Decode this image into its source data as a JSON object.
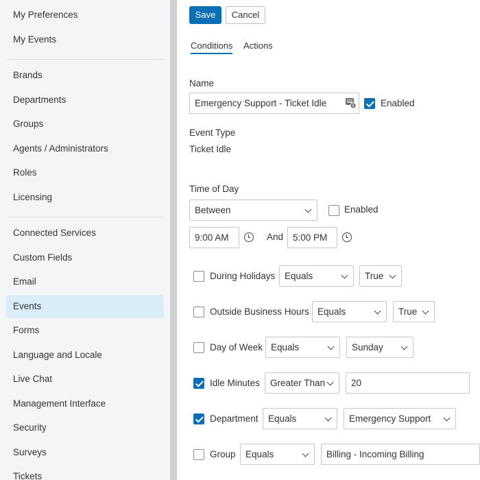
{
  "sidebar": {
    "group1": [
      "My Preferences",
      "My Events"
    ],
    "group2": [
      "Brands",
      "Departments",
      "Groups",
      "Agents / Administrators",
      "Roles",
      "Licensing"
    ],
    "group3": [
      "Connected Services",
      "Custom Fields",
      "Email",
      "Events",
      "Forms",
      "Language and Locale",
      "Live Chat",
      "Management Interface",
      "Security",
      "Surveys",
      "Tickets"
    ],
    "active": "Events"
  },
  "toolbar": {
    "save_label": "Save",
    "cancel_label": "Cancel"
  },
  "tabs": [
    {
      "label": "Conditions",
      "active": true
    },
    {
      "label": "Actions",
      "active": false
    }
  ],
  "form": {
    "name_label": "Name",
    "name_value": "Emergency Support - Ticket Idle",
    "enabled_label": "Enabled",
    "enabled_checked": true,
    "event_type_label": "Event Type",
    "event_type_value": "Ticket Idle",
    "time_of_day_label": "Time of Day",
    "time_of_day_mode": "Between",
    "time_enabled_label": "Enabled",
    "time_enabled_checked": false,
    "start_time": "9:00 AM",
    "and_label": "And",
    "end_time": "5:00 PM"
  },
  "conditions": [
    {
      "label": "During Holidays",
      "checked": false,
      "operator": "Equals",
      "value": "True",
      "value_type": "select"
    },
    {
      "label": "Outside Business Hours",
      "checked": false,
      "operator": "Equals",
      "value": "True",
      "value_type": "select"
    },
    {
      "label": "Day of Week",
      "checked": false,
      "operator": "Equals",
      "value": "Sunday",
      "value_type": "select"
    },
    {
      "label": "Idle Minutes",
      "checked": true,
      "operator": "Greater Than",
      "value": "20",
      "value_type": "input"
    },
    {
      "label": "Department",
      "checked": true,
      "operator": "Equals",
      "value": "Emergency Support",
      "value_type": "select"
    },
    {
      "label": "Group",
      "checked": false,
      "operator": "Equals",
      "value": "Billing - Incoming Billing",
      "value_type": "select"
    }
  ],
  "colors": {
    "accent": "#0a6fb5",
    "active_nav": "#d9ecf8"
  }
}
